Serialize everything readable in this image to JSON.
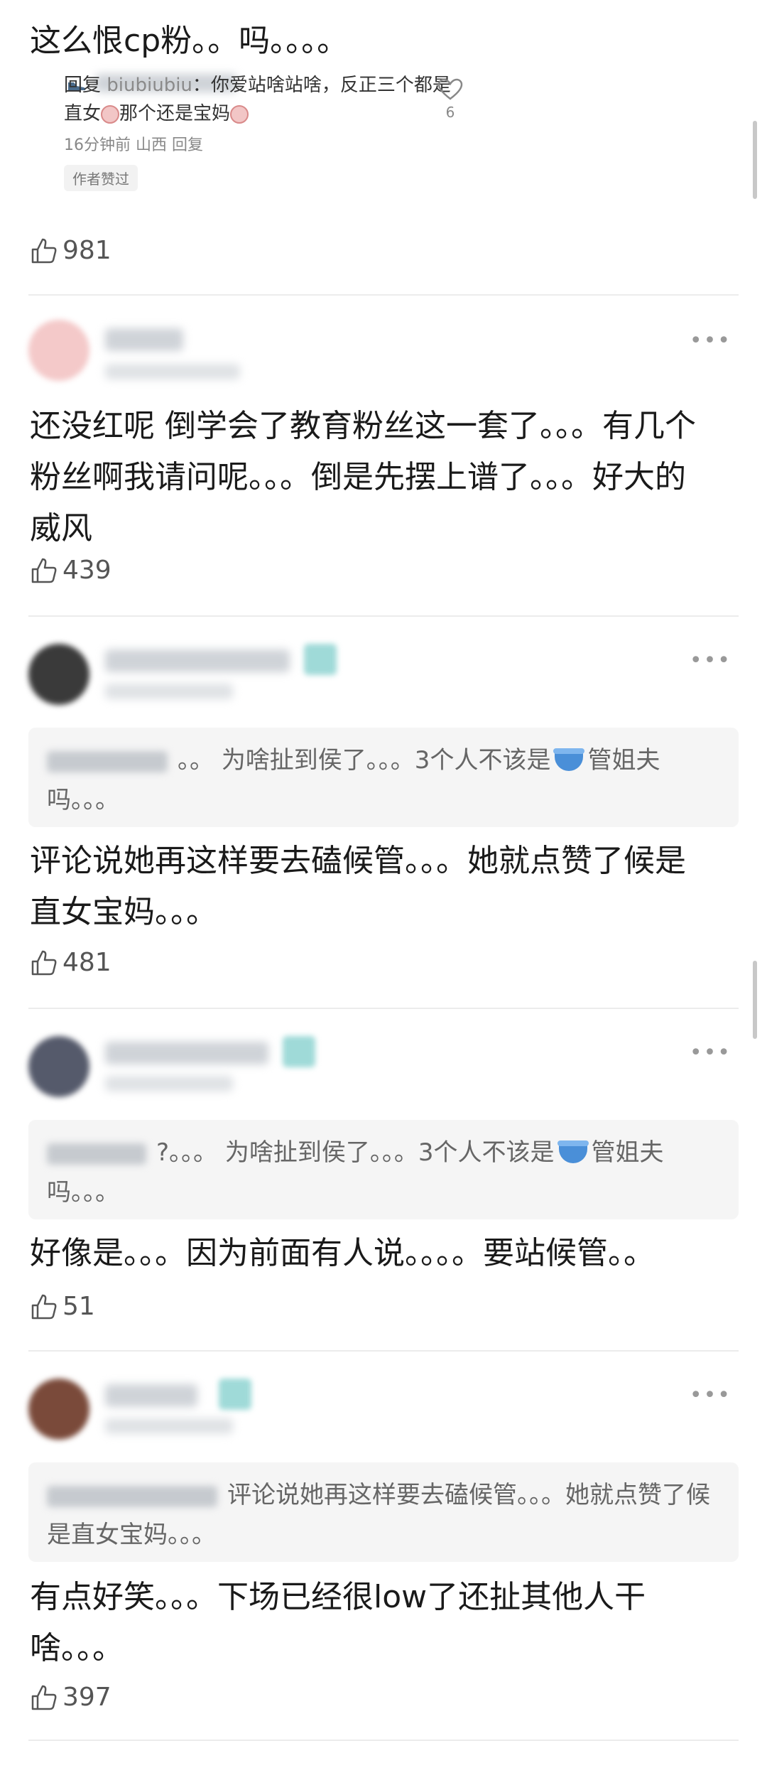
{
  "top_comment": {
    "text": "这么恨cp粉。。吗。。。。",
    "reply": {
      "prefix": "回复",
      "user": "biubiubiu",
      "content_1": "：你爱站啥站啥，反正三个都是直女",
      "content_2": "那个还是宝妈",
      "time": "16分钟前",
      "location": "山西",
      "reply_link": "回复",
      "heart_count": "6",
      "author_liked_tag": "作者赞过"
    },
    "likes": "981"
  },
  "comments": [
    {
      "text": "还没红呢  倒学会了教育粉丝这一套了。。。有几个粉丝啊我请问呢。。。倒是先摆上谱了。。。好大的威风",
      "likes": "439"
    },
    {
      "quote_prefix": "。。",
      "quote_1": "为啥扯到侯了。。。3个人不该是",
      "quote_2": "管姐夫吗。。。",
      "text": "评论说她再这样要去磕候管。。。她就点赞了候是直女宝妈。。。",
      "likes": "481"
    },
    {
      "quote_prefix": "?。。。",
      "quote_1": "为啥扯到侯了。。。3个人不该是",
      "quote_2": "管姐夫吗。。。",
      "text": "好像是。。。因为前面有人说。。。。要站候管。。",
      "likes": "51"
    },
    {
      "quote_prefix": "",
      "quote_1": "评论说她再这样要去磕候管。。。她就点赞了候是直女宝妈。。。",
      "quote_2": "",
      "text": "有点好笑。。。下场已经很low了还扯其他人干啥。。。",
      "likes": "397"
    }
  ],
  "ui": {
    "more_dots": "•••"
  }
}
